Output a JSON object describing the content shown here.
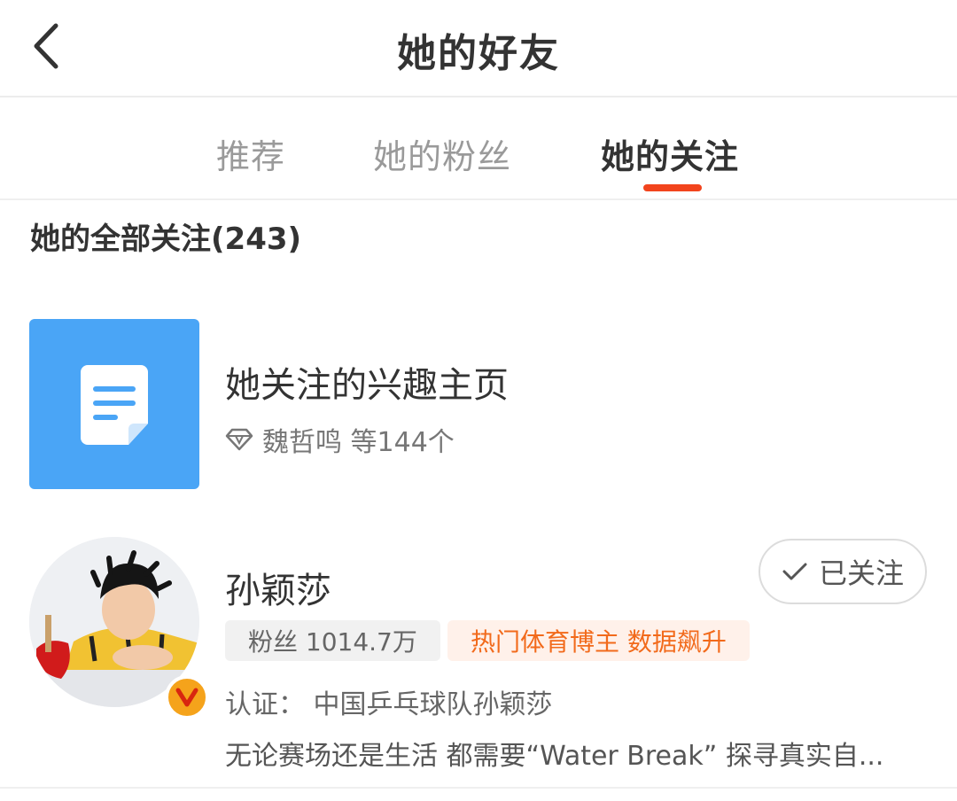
{
  "header": {
    "title": "她的好友",
    "back_icon": "chevron-left-icon"
  },
  "tabs": [
    {
      "label": "推荐",
      "active": false
    },
    {
      "label": "她的粉丝",
      "active": false
    },
    {
      "label": "她的关注",
      "active": true
    }
  ],
  "colors": {
    "accent": "#f2441d",
    "interest_icon_bg": "#4aa5f6",
    "verify_badge": "#f5a31b",
    "hot_tag_text": "#f26a1b"
  },
  "section": {
    "title": "她的全部关注(243)"
  },
  "interest": {
    "icon": "document-icon",
    "title": "她关注的兴趣主页",
    "sub_icon": "diamond-icon",
    "subtitle": "魏哲鸣 等144个"
  },
  "users": [
    {
      "name": "孙颖莎",
      "avatar": "avatar",
      "verified": true,
      "verify_icon": "v-badge-icon",
      "follow_label": "已关注",
      "follow_icon": "check-icon",
      "fans_tag": "粉丝 1014.7万",
      "hot_tag": "热门体育博主 数据飙升",
      "certification": "认证：  中国乒乓球队孙颖莎",
      "bio": "无论赛场还是生活 都需要“Water Break” 探寻真实自..."
    }
  ]
}
